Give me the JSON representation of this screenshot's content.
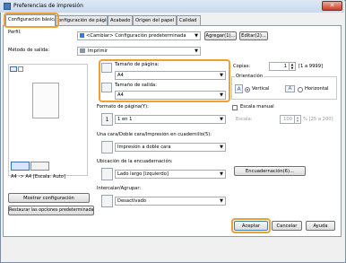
{
  "window": {
    "title": "Preferencias de impresión",
    "close_glyph": "✕"
  },
  "tabs": [
    {
      "label": "Configuración básica"
    },
    {
      "label": "onfiguración de página"
    },
    {
      "label": "Acabado"
    },
    {
      "label": "Origen del papel"
    },
    {
      "label": "Calidad"
    }
  ],
  "profile": {
    "label": "Perfil:",
    "value": "<Cambiar> Configuración predeterminada",
    "add_button": "Agregar(1)...",
    "edit_button": "Editar(2)..."
  },
  "output": {
    "label": "Método de salida:",
    "value": "Imprimir"
  },
  "preview": {
    "caption": "A4 -> A4 [Escala: Auto]"
  },
  "page_size": {
    "label": "Tamaño de página:",
    "value": "A4"
  },
  "output_size": {
    "label": "Tamaño de salida:",
    "value": "A4"
  },
  "copies": {
    "label": "Copias:",
    "value": "1",
    "range": "[1 a 9999]"
  },
  "orientation": {
    "label": "Orientación",
    "portrait": "Vertical",
    "landscape": "Horizontal",
    "glyph": "A"
  },
  "page_layout": {
    "label": "Formato de página(Y):",
    "value": "1 en 1",
    "icon_digit": "1"
  },
  "manual_scaling": {
    "label": "Escala manual",
    "scale_label": "Escala:",
    "scale_value": "100",
    "scale_range": "% [25 a 200]"
  },
  "duplex": {
    "label": "Una cara/Doble cara/Impresión en cuadernillo(5):",
    "value": "Impresión a doble cara"
  },
  "binding": {
    "label": "Ubicación de la encuadernación:",
    "value": "Lado largo [izquierdo]",
    "button": "Encuadernación(6)..."
  },
  "collate": {
    "label": "Intercalar/Agrupar:",
    "value": "Desactivado"
  },
  "left_buttons": {
    "show_settings": "Mostrar configuración",
    "restore_defaults": "Restaurar las opciones predeterminadas"
  },
  "footer": {
    "ok": "Aceptar",
    "cancel": "Cancelar",
    "help": "Ayuda"
  },
  "colors": {
    "highlight": "#f0a030",
    "accent": "#2a6bd1"
  }
}
